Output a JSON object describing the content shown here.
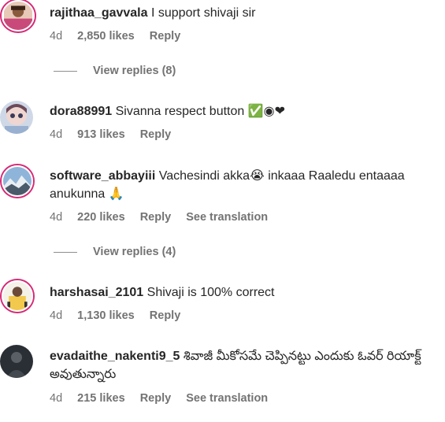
{
  "comments": [
    {
      "username": "rajithaa_gavvala",
      "text": "I support shivaji sir",
      "time": "4d",
      "likes": "2,850 likes",
      "reply": "Reply",
      "view_replies": "View replies (8)"
    },
    {
      "username": "dora88991",
      "text": "Sivanna respect button ✅◉❤",
      "time": "4d",
      "likes": "913 likes",
      "reply": "Reply"
    },
    {
      "username": "software_abbayiii",
      "text": "Vachesindi akka😭 inkaaa Raaledu entaaaa anukunna 🙏",
      "time": "4d",
      "likes": "220 likes",
      "reply": "Reply",
      "see_translation": "See translation",
      "view_replies": "View replies (4)"
    },
    {
      "username": "harshasai_2101",
      "text": "Shivaji is 100% correct",
      "time": "4d",
      "likes": "1,130 likes",
      "reply": "Reply"
    },
    {
      "username": "evadaithe_nakenti9_5",
      "text": "శివాజీ మీకోసమే చెప్పినట్టు ఎందుకు ఓవర్ రియాక్ట్ అవుతున్నారు",
      "time": "4d",
      "likes": "215 likes",
      "reply": "Reply",
      "see_translation": "See translation"
    }
  ],
  "colors": {
    "text_primary": "#262626",
    "text_secondary": "#737373",
    "story_ring": "#d62976"
  }
}
